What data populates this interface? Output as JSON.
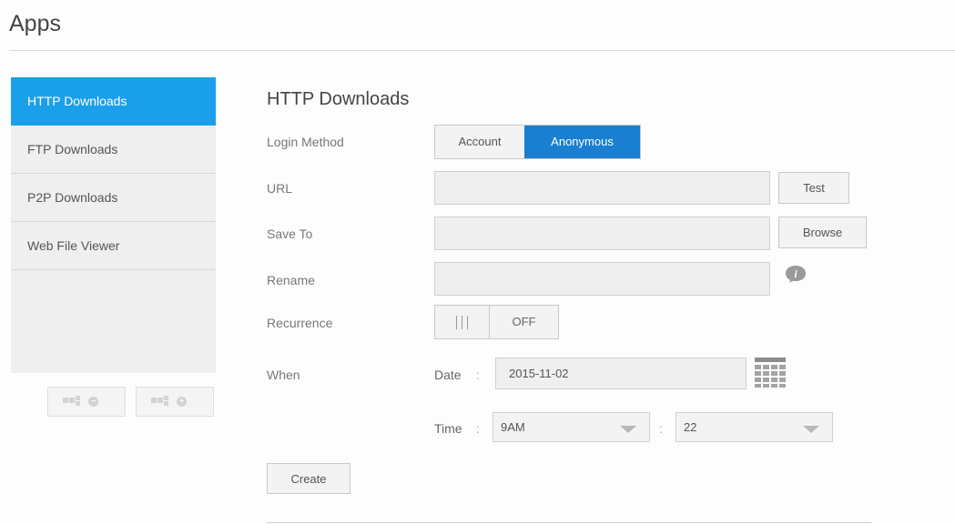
{
  "header": {
    "title": "Apps"
  },
  "sidebar": {
    "items": [
      {
        "label": "HTTP Downloads",
        "active": true
      },
      {
        "label": "FTP Downloads",
        "active": false
      },
      {
        "label": "P2P Downloads",
        "active": false
      },
      {
        "label": "Web File Viewer",
        "active": false
      }
    ],
    "remove_app_icon": "remove-app-icon",
    "add_app_icon": "add-app-icon"
  },
  "main": {
    "section_title": "HTTP Downloads",
    "login_method": {
      "label": "Login Method",
      "options": [
        "Account",
        "Anonymous"
      ],
      "selected": "Anonymous"
    },
    "url": {
      "label": "URL",
      "value": "",
      "test_label": "Test"
    },
    "save_to": {
      "label": "Save To",
      "value": "",
      "browse_label": "Browse"
    },
    "rename": {
      "label": "Rename",
      "value": "",
      "info_icon": "info-icon"
    },
    "recurrence": {
      "label": "Recurrence",
      "handle": "|||",
      "state": "OFF"
    },
    "when": {
      "label": "When",
      "date_label": "Date",
      "date_value": "2015-11-02",
      "calendar_icon": "calendar-icon",
      "time_label": "Time",
      "hour": "9AM",
      "minute": "22",
      "separator": ":"
    },
    "create_label": "Create"
  },
  "colors": {
    "accent": "#1aa0eb",
    "selected_segment": "#1a7fd1"
  }
}
